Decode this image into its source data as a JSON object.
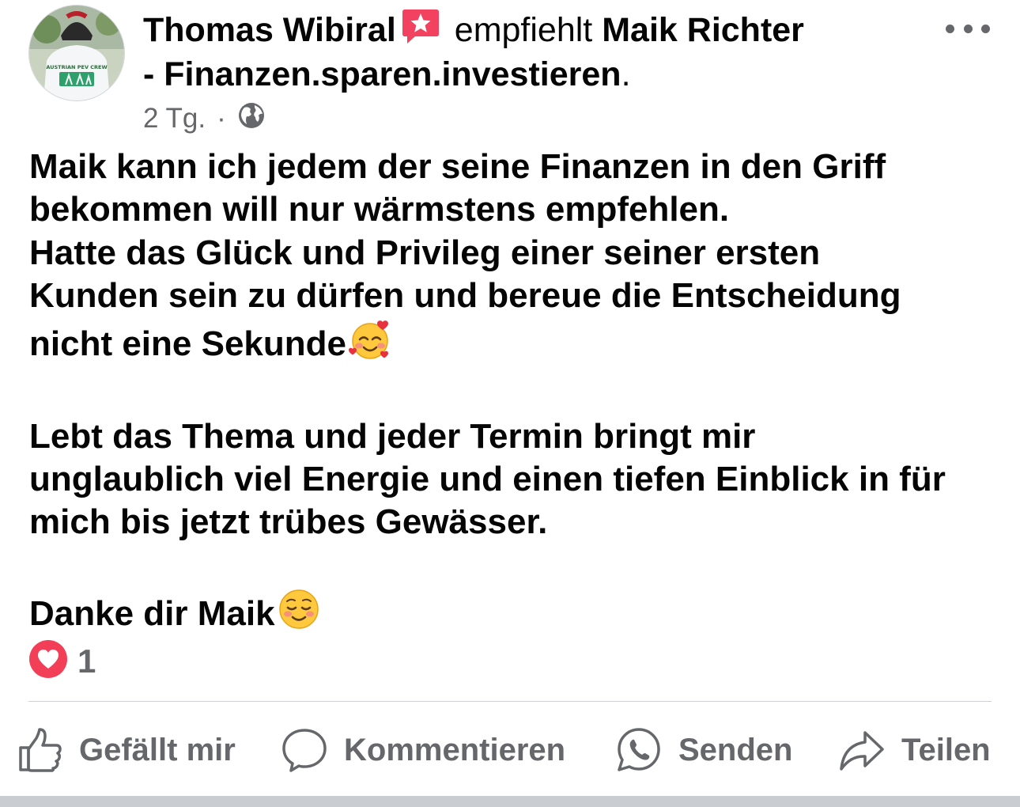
{
  "post": {
    "author": "Thomas Wibiral",
    "verb": "empfiehlt",
    "recommended_page_part1": "Maik Richter",
    "recommended_page_part2": "- Finanzen.sparen.investieren",
    "period": ".",
    "time": "2 Tg.",
    "separator": "·",
    "avatar_shirt_text": "AUSTRIAN PEV CREW",
    "paragraphs": [
      "Maik kann ich jedem der seine Finanzen in den Griff",
      "bekommen will nur wärmstens empfehlen.",
      "Hatte das Glück und Privileg einer seiner ersten",
      "Kunden sein zu dürfen und bereue die Entscheidung",
      "nicht eine Sekunde",
      "Lebt das Thema und jeder Termin bringt mir",
      "unglaublich viel Energie und einen tiefen Einblick in für",
      "mich bis jetzt trübes Gewässer.",
      "Danke dir Maik"
    ],
    "emojis": [
      "smiling-face-with-hearts",
      "smiling-face"
    ]
  },
  "reactions": {
    "type": "love",
    "count": "1"
  },
  "actions": {
    "like": "Gefällt mir",
    "comment": "Kommentieren",
    "send": "Senden",
    "share": "Teilen"
  },
  "colors": {
    "text": "#050505",
    "secondary": "#65676b",
    "love": "#f33e58",
    "badge": "#f3425f",
    "divider": "#ced0d4"
  }
}
